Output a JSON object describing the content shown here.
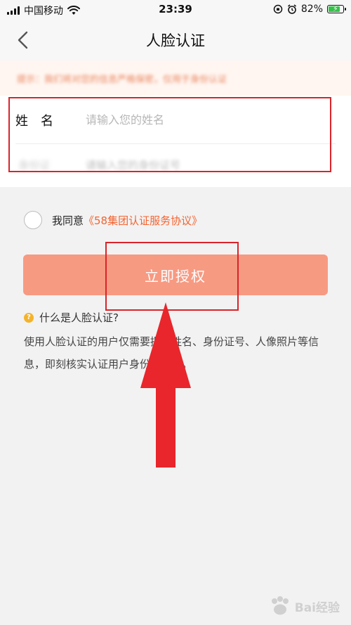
{
  "status_bar": {
    "carrier": "中国移动",
    "time": "23:39",
    "battery_percent": "82%",
    "battery_level": 0.82
  },
  "nav": {
    "back_icon": "chevron-left-icon",
    "title": "人脸认证"
  },
  "notice": {
    "text": "提示：我们将对您的信息严格保密，仅用于身份认证"
  },
  "form": {
    "name_label": "姓名",
    "name_placeholder": "请输入您的姓名",
    "id_label": "身份证",
    "id_placeholder": "请输入您的身份证号"
  },
  "agreement": {
    "prefix": "我同意",
    "link": "《58集团认证服务协议》"
  },
  "auth_button": {
    "label": "立即授权"
  },
  "faq": {
    "title": "什么是人脸认证?",
    "body": "使用人脸认证的用户仅需要提供姓名、身份证号、人像照片等信息，即刻核实认证用户身份真实性。"
  },
  "watermark": {
    "text": "Bai经验"
  },
  "colors": {
    "accent": "#f4632f",
    "button": "#f79a82",
    "highlight": "#d9242a",
    "arrow": "#e8262b"
  }
}
